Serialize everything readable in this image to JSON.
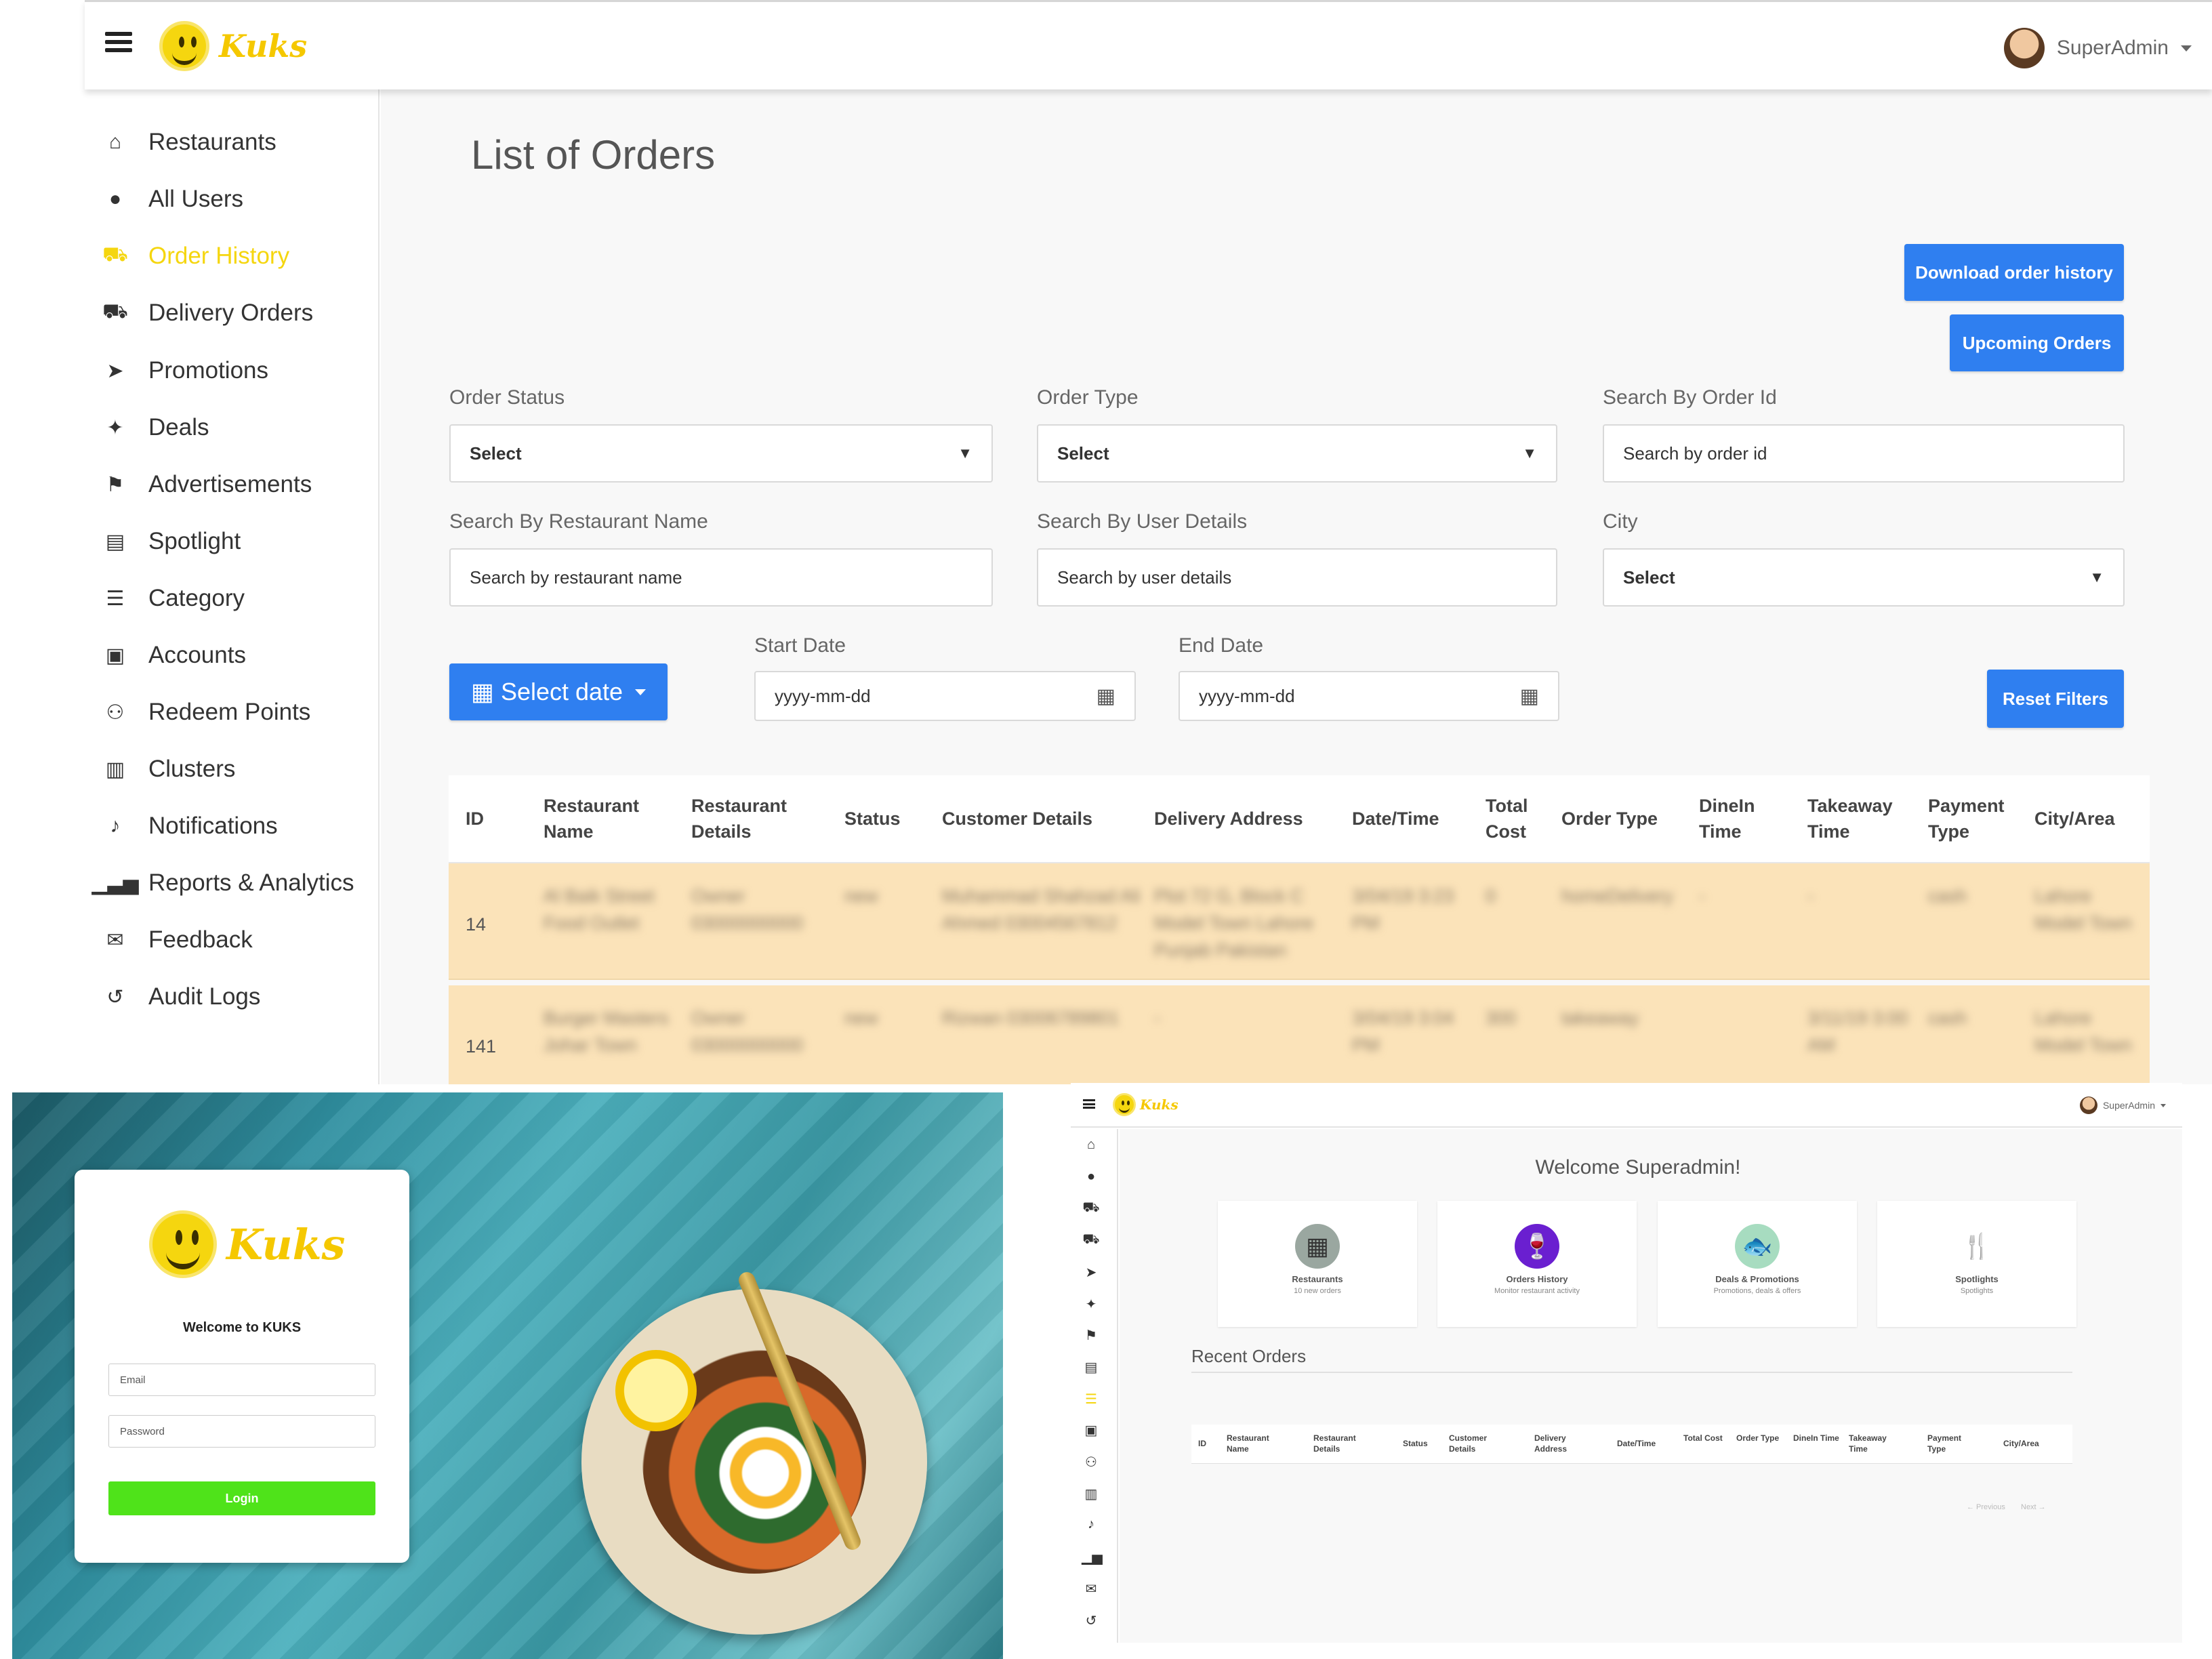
{
  "orders_page": {
    "logo_text": "Kuks",
    "user_name": "SuperAdmin",
    "sidebar": [
      {
        "label": "Restaurants",
        "icon": "home-icon",
        "glyph": "⌂",
        "active": false
      },
      {
        "label": "All Users",
        "icon": "user-icon",
        "glyph": "●",
        "active": false
      },
      {
        "label": "Order History",
        "icon": "cart-icon",
        "glyph": "⛟",
        "active": true
      },
      {
        "label": "Delivery Orders",
        "icon": "cart-icon",
        "glyph": "⛟",
        "active": false
      },
      {
        "label": "Promotions",
        "icon": "paper-plane-icon",
        "glyph": "➤",
        "active": false
      },
      {
        "label": "Deals",
        "icon": "gift-icon",
        "glyph": "✦",
        "active": false
      },
      {
        "label": "Advertisements",
        "icon": "flag-icon",
        "glyph": "⚑",
        "active": false
      },
      {
        "label": "Spotlight",
        "icon": "newspaper-icon",
        "glyph": "▤",
        "active": false
      },
      {
        "label": "Category",
        "icon": "server-icon",
        "glyph": "☰",
        "active": false
      },
      {
        "label": "Accounts",
        "icon": "money-icon",
        "glyph": "▣",
        "active": false
      },
      {
        "label": "Redeem Points",
        "icon": "sitemap-icon",
        "glyph": "⚇",
        "active": false
      },
      {
        "label": "Clusters",
        "icon": "map-icon",
        "glyph": "▥",
        "active": false
      },
      {
        "label": "Notifications",
        "icon": "bell-icon",
        "glyph": "♪",
        "active": false
      },
      {
        "label": "Reports & Analytics",
        "icon": "bar-chart-icon",
        "glyph": "▁▃▅",
        "active": false
      },
      {
        "label": "Feedback",
        "icon": "comments-icon",
        "glyph": "✉",
        "active": false
      },
      {
        "label": "Audit Logs",
        "icon": "history-icon",
        "glyph": "↺",
        "active": false
      }
    ],
    "title": "List of Orders",
    "download_btn": "Download order history",
    "upcoming_btn": "Upcoming Orders",
    "filters": {
      "order_status_label": "Order Status",
      "order_status_value": "Select",
      "order_type_label": "Order Type",
      "order_type_value": "Select",
      "order_id_label": "Search By Order Id",
      "order_id_placeholder": "Search by order id",
      "restaurant_label": "Search By Restaurant Name",
      "restaurant_placeholder": "Search by restaurant name",
      "user_label": "Search By User Details",
      "user_placeholder": "Search by user details",
      "city_label": "City",
      "city_value": "Select",
      "select_date_btn": "Select date",
      "start_date_label": "Start Date",
      "start_date_placeholder": "yyyy-mm-dd",
      "end_date_label": "End Date",
      "end_date_placeholder": "yyyy-mm-dd",
      "reset_btn": "Reset Filters"
    },
    "table": {
      "columns": [
        "ID",
        "Restaurant Name",
        "Restaurant Details",
        "Status",
        "Customer Details",
        "Delivery Address",
        "Date/Time",
        "Total Cost",
        "Order Type",
        "DineIn Time",
        "Takeaway Time",
        "Payment Type",
        "City/Area"
      ],
      "rows": [
        {
          "id": "14",
          "restaurant": "Al Baik Street Food Outlet",
          "details": "Owner 03000000000",
          "status": "new",
          "customer": "Muhammad Shahzad Ali Ahmed 03004567812",
          "address": "Plot 72 G, Block C Model Town Lahore Punjab Pakistan",
          "datetime": "3/04/19 3:23 PM",
          "cost": "0",
          "type": "homeDelivery",
          "dinein": "-",
          "takeaway": "-",
          "payment": "cash",
          "city": "Lahore Model Town"
        },
        {
          "id": "141",
          "restaurant": "Burger Masters Johar Town",
          "details": "Owner 03000000000",
          "status": "new",
          "customer": "Rizwan 03006789801",
          "address": "-",
          "datetime": "3/04/19 3:04 PM",
          "cost": "300",
          "type": "takeaway",
          "dinein": "",
          "takeaway": "3/11/19 3:00 AM",
          "payment": "cash",
          "city": "Lahore Model Town"
        }
      ]
    }
  },
  "login_page": {
    "logo_text": "Kuks",
    "welcome": "Welcome to KUKS",
    "email_placeholder": "Email",
    "password_placeholder": "Password",
    "login_btn": "Login"
  },
  "dashboard_page": {
    "logo_text": "Kuks",
    "user_name": "SuperAdmin",
    "sidebar_icons": [
      {
        "icon": "home-icon",
        "glyph": "⌂",
        "active": false
      },
      {
        "icon": "user-icon",
        "glyph": "●",
        "active": false
      },
      {
        "icon": "cart-icon",
        "glyph": "⛟",
        "active": false
      },
      {
        "icon": "cart-icon",
        "glyph": "⛟",
        "active": false
      },
      {
        "icon": "paper-plane-icon",
        "glyph": "➤",
        "active": false
      },
      {
        "icon": "gift-icon",
        "glyph": "✦",
        "active": false
      },
      {
        "icon": "flag-icon",
        "glyph": "⚑",
        "active": false
      },
      {
        "icon": "newspaper-icon",
        "glyph": "▤",
        "active": false
      },
      {
        "icon": "server-icon",
        "glyph": "☰",
        "active": true
      },
      {
        "icon": "money-icon",
        "glyph": "▣",
        "active": false
      },
      {
        "icon": "sitemap-icon",
        "glyph": "⚇",
        "active": false
      },
      {
        "icon": "map-icon",
        "glyph": "▥",
        "active": false
      },
      {
        "icon": "bell-icon",
        "glyph": "♪",
        "active": false
      },
      {
        "icon": "bar-chart-icon",
        "glyph": "▁▅",
        "active": false
      },
      {
        "icon": "comments-icon",
        "glyph": "✉",
        "active": false
      },
      {
        "icon": "history-icon",
        "glyph": "↺",
        "active": false
      }
    ],
    "welcome": "Welcome Superadmin!",
    "cards": [
      {
        "title": "Restaurants",
        "sub": "10 new orders",
        "icon": "building-icon",
        "glyph": "▦",
        "bg": "#9aa7a0"
      },
      {
        "title": "Orders History",
        "sub": "Monitor restaurant activity",
        "icon": "wine-glass-icon",
        "glyph": "🍷",
        "bg": "#6a1fd0"
      },
      {
        "title": "Deals & Promotions",
        "sub": "Promotions, deals & offers",
        "icon": "fish-dish-icon",
        "glyph": "🐟",
        "bg": "#a7dcc0"
      },
      {
        "title": "Spotlights",
        "sub": "Spotlights",
        "icon": "fork-knife-icon",
        "glyph": "🍴",
        "bg": "#ffffff"
      }
    ],
    "recent_orders": "Recent Orders",
    "columns": [
      "ID",
      "Restaurant Name",
      "Restaurant Details",
      "Status",
      "Customer Details",
      "Delivery Address",
      "Date/Time",
      "Total Cost",
      "Order Type",
      "DineIn Time",
      "Takeaway Time",
      "Payment Type",
      "City/Area"
    ],
    "pager_prev": "← Previous",
    "pager_next": "Next →"
  }
}
